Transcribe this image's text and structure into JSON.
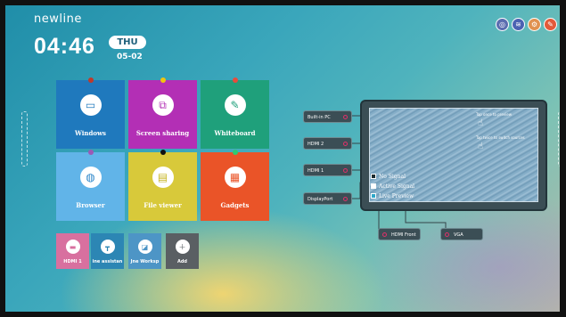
{
  "brand": "newline",
  "clock": {
    "time": "04:46",
    "weekday": "THU",
    "date": "05-02"
  },
  "top_icons": [
    {
      "name": "settings-ring-icon",
      "color": "#5b6db0"
    },
    {
      "name": "signal-icon",
      "color": "#4b62b3"
    },
    {
      "name": "gear-icon",
      "color": "#e0914f"
    },
    {
      "name": "whiteboard-note-icon",
      "color": "#e25a3a"
    }
  ],
  "tiles": [
    {
      "label": "Windows",
      "color": "#1f79bd",
      "icon": "pc-icon"
    },
    {
      "label": "Screen sharing",
      "color": "#b32fb5",
      "icon": "screen-share-icon"
    },
    {
      "label": "Whiteboard",
      "color": "#1fa07b",
      "icon": "pencil-icon"
    },
    {
      "label": "Browser",
      "color": "#61b4e8",
      "icon": "globe-icon"
    },
    {
      "label": "File viewer",
      "color": "#d8c93a",
      "icon": "folder-icon"
    },
    {
      "label": "Gadgets",
      "color": "#ea5428",
      "icon": "grid-icon"
    }
  ],
  "small_tiles": [
    {
      "label": "HDMI 1",
      "color": "#d8709f",
      "icon": "hdmi-icon"
    },
    {
      "label": "ine assistan",
      "color": "#2c86b4",
      "icon": "tripod-icon"
    },
    {
      "label": "Jne Worksp",
      "color": "#4d95c6",
      "icon": "workspace-icon"
    },
    {
      "label": "Add",
      "color": "#5a5f63",
      "icon": "plus-icon"
    }
  ],
  "sources": [
    "Built-in PC",
    "HDMI 2",
    "HDMI 1",
    "DisplayPort"
  ],
  "outputs": [
    "HDMI Front",
    "VGA"
  ],
  "monitor_legend": [
    {
      "label": "No Signal",
      "color": "#1b2b2f"
    },
    {
      "label": "Active Signal",
      "color": "#ffffff"
    },
    {
      "label": "Live Preview",
      "color": "#2ea7c9"
    }
  ],
  "hints": [
    "Tap once to preview",
    "Tap twice to switch sources"
  ]
}
